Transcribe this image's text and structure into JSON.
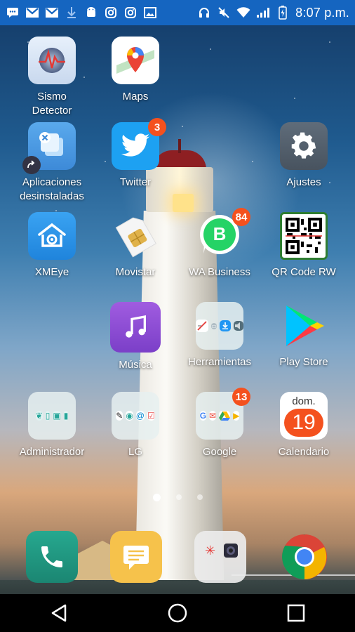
{
  "statusbar": {
    "time": "8:07 p.m.",
    "left_icons": [
      "chat-icon",
      "gmail-icon",
      "gmail-icon",
      "download-icon",
      "android-icon",
      "instagram-icon",
      "instagram-icon",
      "gallery-icon"
    ],
    "right_icons": [
      "headset-icon",
      "mute-icon",
      "wifi-icon",
      "signal-icon",
      "battery-icon"
    ]
  },
  "apps": {
    "sismo": {
      "label": "Sismo\nDetector"
    },
    "maps": {
      "label": "Maps"
    },
    "aplicaciones": {
      "label": "Aplicaciones\ndesinstaladas"
    },
    "twitter": {
      "label": "Twitter",
      "badge": "3"
    },
    "ajustes": {
      "label": "Ajustes"
    },
    "xmeye": {
      "label": "XMEye"
    },
    "movistar": {
      "label": "Movistar"
    },
    "wabusiness": {
      "label": "WA Business",
      "badge": "84",
      "icon_letter": "B"
    },
    "qrcode": {
      "label": "QR Code RW"
    },
    "musica": {
      "label": "Música"
    },
    "herramientas": {
      "label": "Herramientas"
    },
    "playstore": {
      "label": "Play Store"
    },
    "administrador": {
      "label": "Administrador"
    },
    "lg": {
      "label": "LG"
    },
    "google": {
      "label": "Google",
      "badge": "13"
    },
    "calendario": {
      "label": "Calendario",
      "day_name": "dom.",
      "day_number": "19"
    }
  },
  "page_indicator": {
    "pages": 3,
    "active": 0
  },
  "dock": [
    "phone-icon",
    "messages-icon",
    "camera-folder-icon",
    "chrome-icon"
  ],
  "navbar": [
    "back-button",
    "home-button",
    "recents-button"
  ],
  "colors": {
    "statusbar": "#1565c0",
    "badge": "#f4511e",
    "navbar": "#000000"
  }
}
